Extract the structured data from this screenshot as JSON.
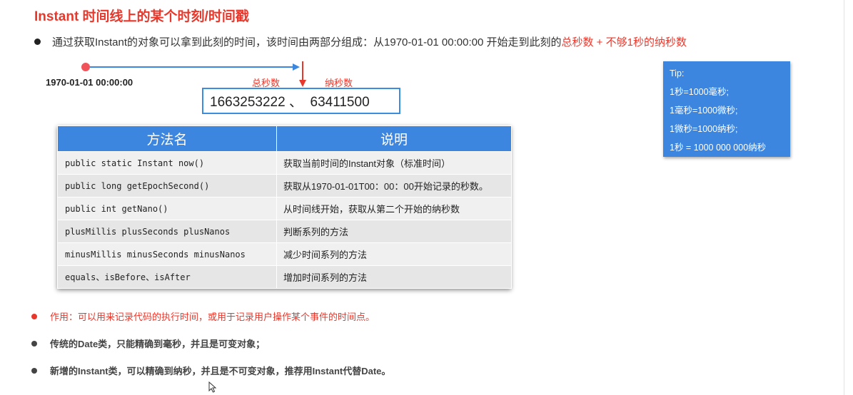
{
  "title": "Instant 时间线上的某个时刻/时间戳",
  "intro": {
    "text": "通过获取Instant的对象可以拿到此刻的时间，该时间由两部分组成：从1970-01-01 00:00:00 开始走到此刻的",
    "highlight": "总秒数 + 不够1秒的纳秒数"
  },
  "timeline": {
    "origin_label": "1970-01-01 00:00:00",
    "seconds_label": "总秒数",
    "nanos_label": "纳秒数",
    "value": "1663253222 、  63411500"
  },
  "tip": {
    "lines": [
      "Tip:",
      "1秒=1000毫秒;",
      "1毫秒=1000微秒;",
      "1微秒=1000纳秒;",
      "1秒 = 1000 000 000纳秒"
    ]
  },
  "table": {
    "headers": [
      "方法名",
      "说明"
    ],
    "rows": [
      [
        "public static Instant now()",
        "获取当前时间的Instant对象（标准时间）"
      ],
      [
        "public long getEpochSecond()",
        "获取从1970-01-01T00：00：00开始记录的秒数。"
      ],
      [
        "public int getNano()",
        "从时间线开始，获取从第二个开始的纳秒数"
      ],
      [
        "plusMillis plusSeconds plusNanos",
        "判断系列的方法"
      ],
      [
        "minusMillis minusSeconds minusNanos",
        "减少时间系列的方法"
      ],
      [
        "equals、isBefore、isAfter",
        "增加时间系列的方法"
      ]
    ]
  },
  "bullets": [
    "作用：可以用来记录代码的执行时间，或用于记录用户操作某个事件的时间点。",
    "传统的Date类，只能精确到毫秒，并且是可变对象；",
    "新增的Instant类，可以精确到纳秒，并且是不可变对象，推荐用Instant代替Date。"
  ],
  "colors": {
    "accent_red": "#e8382c",
    "accent_blue": "#3c86e0"
  },
  "icons": {
    "cursor": "mouse-pointer-icon"
  }
}
